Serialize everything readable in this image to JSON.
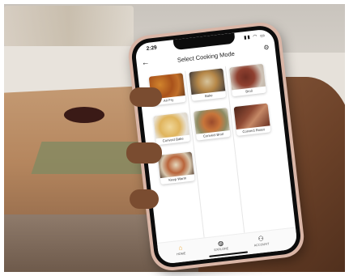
{
  "status_bar": {
    "time": "2:29",
    "icons": "▮▮ ◠ ▭"
  },
  "header": {
    "title": "Select Cooking Mode",
    "back_glyph": "←",
    "settings_glyph": "⚙"
  },
  "modes": [
    {
      "label": "Air Fry",
      "icon": "air-fry-food-image"
    },
    {
      "label": "Bake",
      "icon": "bake-food-image"
    },
    {
      "label": "Broil",
      "icon": "broil-food-image"
    },
    {
      "label": "Convect Bake",
      "icon": "convect-bake-food-image"
    },
    {
      "label": "Convect Broil",
      "icon": "convect-broil-food-image"
    },
    {
      "label": "Convect Roast",
      "icon": "convect-roast-food-image"
    },
    {
      "label": "Keep Warm",
      "icon": "keep-warm-food-image"
    }
  ],
  "nav": {
    "home": {
      "label": "HOME",
      "glyph": "⌂",
      "color": "#f0a830"
    },
    "explore": {
      "label": "EXPLORE",
      "glyph": "◍"
    },
    "account": {
      "label": "ACCOUNT",
      "glyph": "⚇"
    }
  }
}
